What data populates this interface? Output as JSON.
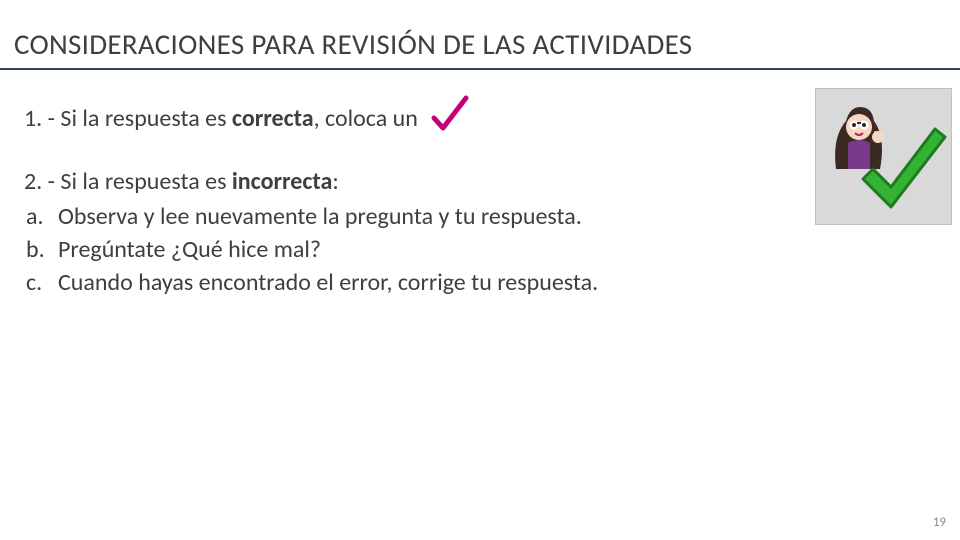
{
  "title": "CONSIDERACIONES PARA REVISIÓN DE LAS ACTIVIDADES",
  "item1": {
    "prefix": "1. - Si la respuesta es ",
    "bold": "correcta",
    "suffix": ", coloca un"
  },
  "item2": {
    "prefix": "2. - Si la respuesta es ",
    "bold": "incorrecta",
    "suffix": ":"
  },
  "sub": {
    "a": {
      "label": "a.",
      "text": " Observa y lee nuevamente la pregunta y tu respuesta."
    },
    "b": {
      "label": "b.",
      "text": "Pregúntate ¿Qué hice mal?"
    },
    "c": {
      "label": "c.",
      "text": "Cuando hayas encontrado el error, corrige tu respuesta."
    }
  },
  "pageNumber": "19"
}
